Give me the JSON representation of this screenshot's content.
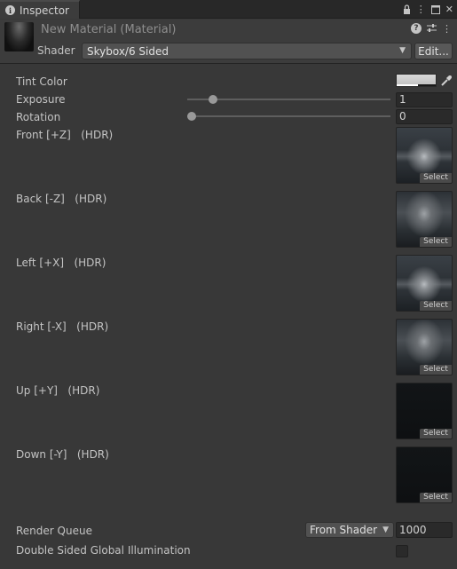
{
  "tab": {
    "title": "Inspector"
  },
  "header": {
    "material_name": "New Material (Material)",
    "shader_label": "Shader",
    "shader_value": "Skybox/6 Sided",
    "edit_label": "Edit..."
  },
  "properties": {
    "tint_color": {
      "label": "Tint Color"
    },
    "exposure": {
      "label": "Exposure",
      "value": "1",
      "slider_fraction": 0.125
    },
    "rotation": {
      "label": "Rotation",
      "value": "0",
      "slider_fraction": 0.0
    },
    "textures": [
      {
        "label": "Front [+Z]   (HDR)",
        "select": "Select"
      },
      {
        "label": "Back [-Z]   (HDR)",
        "select": "Select"
      },
      {
        "label": "Left [+X]   (HDR)",
        "select": "Select"
      },
      {
        "label": "Right [-X]   (HDR)",
        "select": "Select"
      },
      {
        "label": "Up [+Y]   (HDR)",
        "select": "Select"
      },
      {
        "label": "Down [-Y]   (HDR)",
        "select": "Select"
      }
    ],
    "render_queue": {
      "label": "Render Queue",
      "mode": "From Shader",
      "value": "1000"
    },
    "double_sided_gi": {
      "label": "Double Sided Global Illumination",
      "checked": false
    }
  }
}
